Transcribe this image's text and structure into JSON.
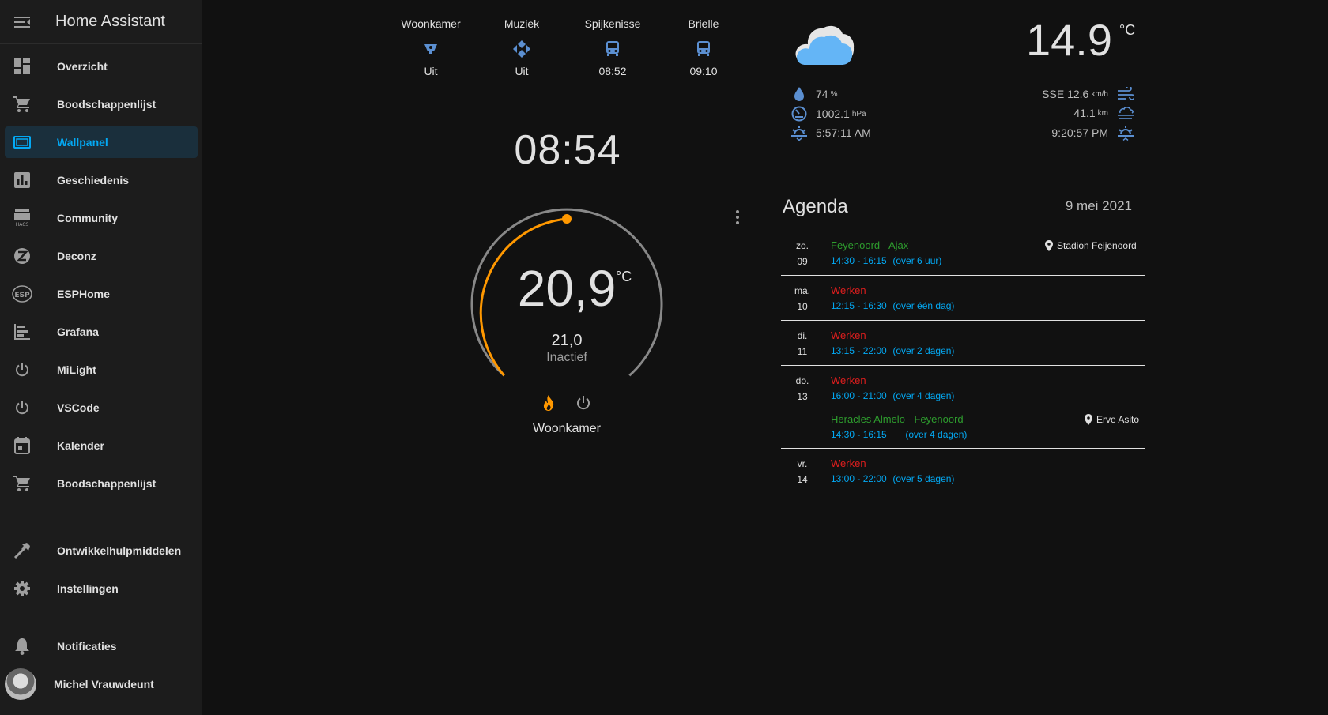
{
  "app_title": "Home Assistant",
  "sidebar": {
    "items": [
      {
        "label": "Overzicht",
        "icon": "dashboard-icon"
      },
      {
        "label": "Boodschappenlijst",
        "icon": "cart-icon"
      },
      {
        "label": "Wallpanel",
        "icon": "tablet-icon",
        "active": true
      },
      {
        "label": "Geschiedenis",
        "icon": "chart-bar-icon"
      },
      {
        "label": "Community",
        "icon": "hacs-icon"
      },
      {
        "label": "Deconz",
        "icon": "zigbee-icon"
      },
      {
        "label": "ESPHome",
        "icon": "esphome-icon"
      },
      {
        "label": "Grafana",
        "icon": "chart-timeline-icon"
      },
      {
        "label": "MiLight",
        "icon": "power-icon"
      },
      {
        "label": "VSCode",
        "icon": "power-icon"
      },
      {
        "label": "Kalender",
        "icon": "calendar-icon"
      },
      {
        "label": "Boodschappenlijst",
        "icon": "cart-icon"
      }
    ],
    "developer_tools": "Ontwikkelhulpmiddelen",
    "settings": "Instellingen",
    "notifications": "Notificaties",
    "user": "Michel Vrauwdeunt"
  },
  "status": [
    {
      "name": "Woonkamer",
      "value": "Uit",
      "icon": "speaker-icon"
    },
    {
      "name": "Muziek",
      "value": "Uit",
      "icon": "kodi-icon"
    },
    {
      "name": "Spijkenisse",
      "value": "08:52",
      "icon": "bus-icon"
    },
    {
      "name": "Brielle",
      "value": "09:10",
      "icon": "bus-icon"
    }
  ],
  "clock": "08:54",
  "thermostat": {
    "current": "20,9",
    "unit": "°C",
    "target": "21,0",
    "state": "Inactief",
    "name": "Woonkamer",
    "level": 0.5,
    "colors": {
      "heat": "#ff9800",
      "track": "#888888"
    }
  },
  "weather": {
    "temperature": "14.9",
    "unit": "°C",
    "humidity": "74",
    "humidity_unit": "%",
    "pressure": "1002.1",
    "pressure_unit": "hPa",
    "sunrise": "5:57:11 AM",
    "wind": "SSE 12.6",
    "wind_unit": "km/h",
    "visibility": "41.1",
    "visibility_unit": "km",
    "sunset": "9:20:57 PM",
    "icon_color": "#64b5f6"
  },
  "agenda": {
    "title": "Agenda",
    "date": "9 mei 2021",
    "days": [
      {
        "dow": "zo.",
        "day": "09",
        "events": [
          {
            "title": "Feyenoord - Ajax",
            "time": "14:30 - 16:15",
            "rel": "(over 6 uur)",
            "color": "green",
            "location": "Stadion Feijenoord"
          }
        ]
      },
      {
        "dow": "ma.",
        "day": "10",
        "events": [
          {
            "title": "Werken",
            "time": "12:15 - 16:30",
            "rel": "(over één dag)",
            "color": "red"
          }
        ]
      },
      {
        "dow": "di.",
        "day": "11",
        "events": [
          {
            "title": "Werken",
            "time": "13:15 - 22:00",
            "rel": "(over 2 dagen)",
            "color": "red"
          }
        ]
      },
      {
        "dow": "do.",
        "day": "13",
        "events": [
          {
            "title": "Werken",
            "time": "16:00 - 21:00",
            "rel": "(over 4 dagen)",
            "color": "red"
          },
          {
            "title": "Heracles Almelo - Feyenoord",
            "time": "14:30 - 16:15",
            "rel": "(over 4 dagen)",
            "color": "green",
            "location": "Erve Asito"
          }
        ]
      },
      {
        "dow": "vr.",
        "day": "14",
        "events": [
          {
            "title": "Werken",
            "time": "13:00 - 22:00",
            "rel": "(over 5 dagen)",
            "color": "red"
          }
        ]
      }
    ]
  }
}
